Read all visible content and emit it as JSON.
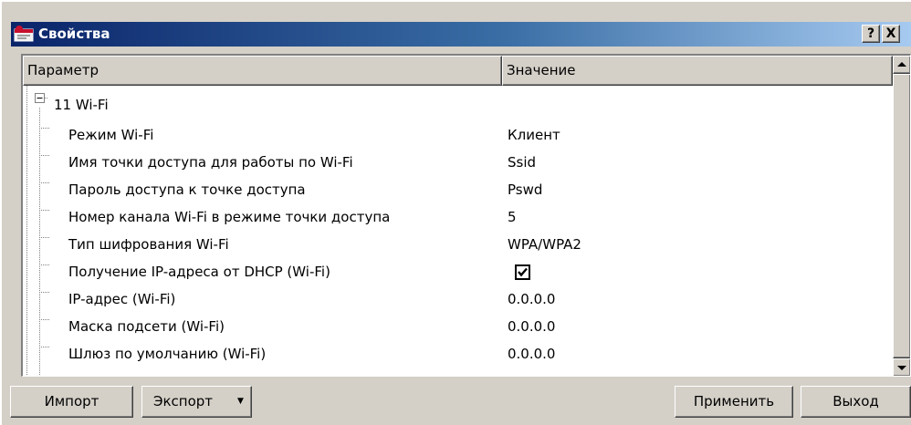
{
  "window": {
    "title": "Свойства",
    "help_label": "?",
    "close_label": "X"
  },
  "grid": {
    "columns": {
      "param": "Параметр",
      "value": "Значение"
    },
    "group": {
      "toggle": "−",
      "label": "11 Wi-Fi"
    },
    "rows": [
      {
        "label": "Режим Wi-Fi",
        "value": "Клиент"
      },
      {
        "label": "Имя точки доступа для работы по Wi-Fi",
        "value": "Ssid"
      },
      {
        "label": "Пароль доступа к точке доступа",
        "value": "Pswd"
      },
      {
        "label": "Номер канала Wi-Fi в режиме точки доступа",
        "value": "5"
      },
      {
        "label": "Тип шифрования Wi-Fi",
        "value": "WPA/WPA2"
      },
      {
        "label": "Получение IP-адреса от DHCP (Wi-Fi)",
        "value": "",
        "checked": true
      },
      {
        "label": "IP-адрес (Wi-Fi)",
        "value": "0.0.0.0"
      },
      {
        "label": "Маска подсети (Wi-Fi)",
        "value": "0.0.0.0"
      },
      {
        "label": "Шлюз по умолчанию (Wi-Fi)",
        "value": "0.0.0.0"
      }
    ]
  },
  "buttons": {
    "import": "Импорт",
    "export": "Экспорт",
    "apply": "Применить",
    "exit": "Выход"
  }
}
